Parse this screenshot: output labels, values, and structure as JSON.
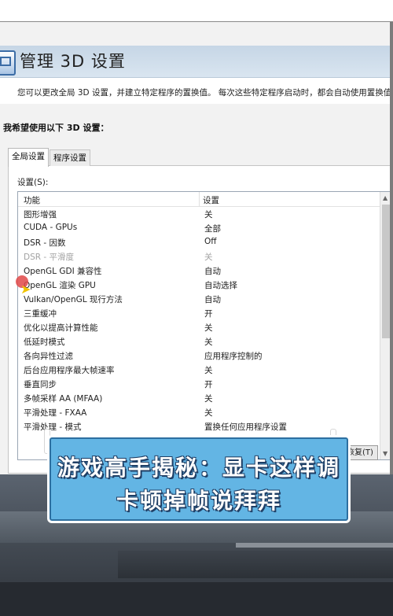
{
  "window": {
    "title": "管理 3D 设置",
    "description": "您可以更改全局 3D 设置，并建立特定程序的置换值。 每次这些特定程序启动时，都会自动使用置换值。",
    "section_label": "我希望使用以下 3D 设置：",
    "tabs": [
      {
        "label": "全局设置",
        "active": true
      },
      {
        "label": "程序设置",
        "active": false
      }
    ],
    "settings_label": "设置(S):",
    "columns": {
      "feature": "功能",
      "setting": "设置"
    },
    "rows": [
      {
        "feature": "图形增强",
        "value": "关",
        "disabled": false
      },
      {
        "feature": "CUDA - GPUs",
        "value": "全部",
        "disabled": false
      },
      {
        "feature": "DSR - 因数",
        "value": "Off",
        "disabled": false
      },
      {
        "feature": "DSR - 平滑度",
        "value": "关",
        "disabled": true
      },
      {
        "feature": "OpenGL GDI 兼容性",
        "value": "自动",
        "disabled": false
      },
      {
        "feature": "OpenGL 渲染 GPU",
        "value": "自动选择",
        "disabled": false
      },
      {
        "feature": "Vulkan/OpenGL 现行方法",
        "value": "自动",
        "disabled": false
      },
      {
        "feature": "三重缓冲",
        "value": "开",
        "disabled": false
      },
      {
        "feature": "优化以提高计算性能",
        "value": "关",
        "disabled": false
      },
      {
        "feature": "低延时模式",
        "value": "关",
        "disabled": false
      },
      {
        "feature": "各向异性过滤",
        "value": "应用程序控制的",
        "disabled": false
      },
      {
        "feature": "后台应用程序最大帧速率",
        "value": "关",
        "disabled": false
      },
      {
        "feature": "垂直同步",
        "value": "开",
        "disabled": false
      },
      {
        "feature": "多帧采样 AA (MFAA)",
        "value": "关",
        "disabled": false
      },
      {
        "feature": "平滑处理 - FXAA",
        "value": "关",
        "disabled": false
      },
      {
        "feature": "平滑处理 - 模式",
        "value": "置换任何应用程序设置",
        "disabled": false
      }
    ],
    "restore_button": "恢复(T)"
  },
  "caption": {
    "line1": "游戏高手揭秘：显卡这样调",
    "line2": "卡顿掉帧说拜拜"
  },
  "icons": {
    "app": "nvidia-3d-settings-icon",
    "cursor": "mouse-cursor-icon"
  }
}
